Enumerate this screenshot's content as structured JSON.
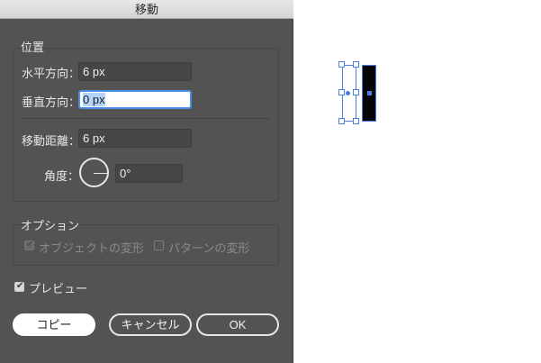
{
  "dialog": {
    "title": "移動",
    "position": {
      "legend": "位置",
      "horizontal_label": "水平方向：",
      "horizontal_value": "6 px",
      "vertical_label": "垂直方向：",
      "vertical_value": "0 px",
      "distance_label": "移動距離：",
      "distance_value": "6 px",
      "angle_label": "角度：",
      "angle_value": "0°"
    },
    "options": {
      "legend": "オプション",
      "transform_objects_label": "オブジェクトの変形",
      "transform_patterns_label": "パターンの変形"
    },
    "preview_label": "プレビュー",
    "buttons": {
      "copy": "コピー",
      "cancel": "キャンセル",
      "ok": "OK"
    }
  },
  "colors": {
    "dialog_bg": "#535353",
    "accent": "#4a7fe8",
    "canvas_bg": "#ffffff"
  }
}
